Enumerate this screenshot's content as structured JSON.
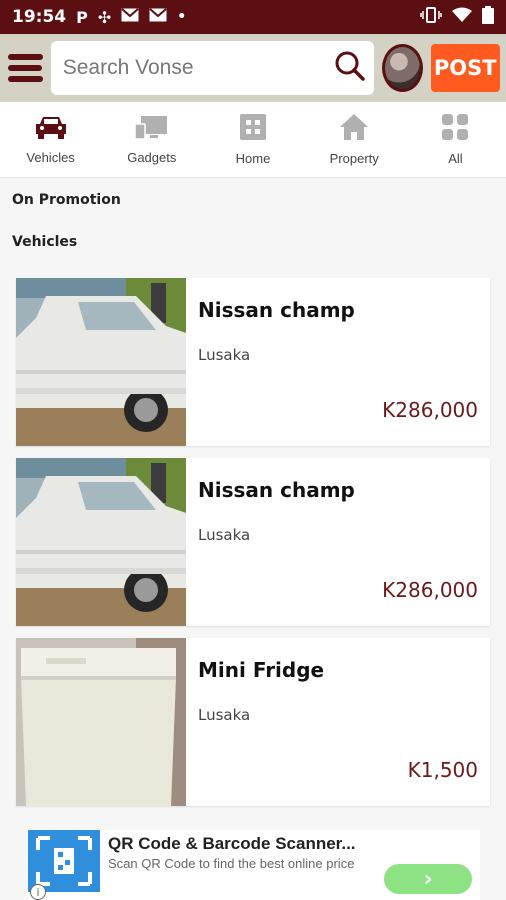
{
  "status_bar": {
    "time": "19:54",
    "icons": [
      "p-icon",
      "slack-icon",
      "gmail-icon",
      "gmail-icon",
      "dot-icon",
      "vibrate-icon",
      "wifi-icon",
      "battery-icon"
    ]
  },
  "app_bar": {
    "search_placeholder": "Search Vonse",
    "post_label": "POST",
    "colors": {
      "bar": "#d4d2c4",
      "brand": "#5b0f12",
      "post": "#ff5a1f"
    }
  },
  "categories": [
    {
      "label": "Vehicles",
      "icon": "car-icon",
      "active": true
    },
    {
      "label": "Gadgets",
      "icon": "gadgets-icon",
      "active": false
    },
    {
      "label": "Home",
      "icon": "home-grid-icon",
      "active": false
    },
    {
      "label": "Property",
      "icon": "house-icon",
      "active": false
    },
    {
      "label": "All",
      "icon": "all-grid-icon",
      "active": false
    }
  ],
  "sections": {
    "promotion": "On Promotion",
    "vehicles": "Vehicles"
  },
  "listings": [
    {
      "title": "Nissan champ",
      "location": "Lusaka",
      "price": "K286,000",
      "image": "white-pickup-truck"
    },
    {
      "title": "Nissan champ",
      "location": "Lusaka",
      "price": "K286,000",
      "image": "white-pickup-truck"
    },
    {
      "title": "Mini Fridge",
      "location": "Lusaka",
      "price": "K1,500",
      "image": "white-mini-fridge"
    }
  ],
  "ad": {
    "title": "QR Code & Barcode Scanner...",
    "subtitle": "Scan QR Code to find the best online price",
    "info": "i",
    "cta_icon": "chevron-right-icon"
  }
}
